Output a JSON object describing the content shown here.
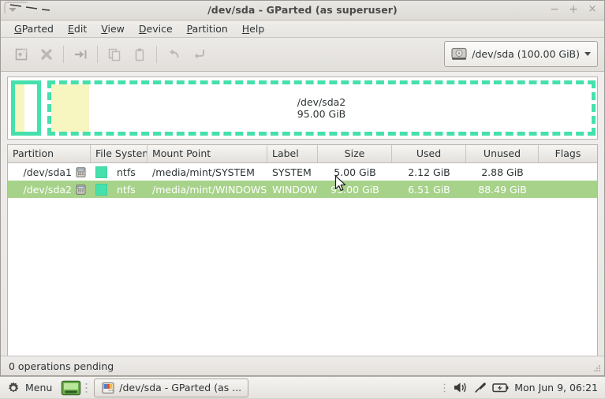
{
  "window": {
    "title": "/dev/sda - GParted (as superuser)",
    "controls": {
      "minimize": "−",
      "maximize": "+",
      "close": "×"
    }
  },
  "menubar": {
    "items": [
      {
        "label": "GParted",
        "mnemonic": "G"
      },
      {
        "label": "Edit",
        "mnemonic": "E"
      },
      {
        "label": "View",
        "mnemonic": "V"
      },
      {
        "label": "Device",
        "mnemonic": "D"
      },
      {
        "label": "Partition",
        "mnemonic": "P"
      },
      {
        "label": "Help",
        "mnemonic": "H"
      }
    ]
  },
  "toolbar": {
    "buttons": [
      {
        "name": "new-partition-icon",
        "enabled": false
      },
      {
        "name": "delete-partition-icon",
        "enabled": false
      },
      {
        "name": "resize-move-icon",
        "enabled": false
      },
      {
        "name": "copy-icon",
        "enabled": false
      },
      {
        "name": "paste-icon",
        "enabled": false
      },
      {
        "name": "undo-icon",
        "enabled": false
      },
      {
        "name": "apply-icon",
        "enabled": false
      }
    ],
    "device_selector": {
      "label": "/dev/sda  (100.00 GiB)",
      "icon": "harddisk-icon",
      "caret": "▼"
    }
  },
  "disk_graphic": {
    "blocks": [
      {
        "name": "/dev/sda1",
        "size_label": "5.00 GiB",
        "used_percent": 42,
        "selected": false,
        "show_caption": false,
        "border_color": "#45e0ab",
        "used_color": "#f7f5c0"
      },
      {
        "name": "/dev/sda2",
        "size_label": "95.00 GiB",
        "used_percent": 7,
        "selected": true,
        "show_caption": true,
        "border_color": "#45e0ab",
        "used_color": "#f7f5c0"
      }
    ]
  },
  "table": {
    "headers": [
      "Partition",
      "File System",
      "Mount Point",
      "Label",
      "Size",
      "Used",
      "Unused",
      "Flags"
    ],
    "rows": [
      {
        "partition": "/dev/sda1",
        "filesystem": "ntfs",
        "mount_point": "/media/mint/SYSTEM",
        "label": "SYSTEM",
        "size": "5.00 GiB",
        "used": "2.12 GiB",
        "unused": "2.88 GiB",
        "flags": "",
        "selected": false,
        "fs_color": "#45e0ab"
      },
      {
        "partition": "/dev/sda2",
        "filesystem": "ntfs",
        "mount_point": "/media/mint/WINDOWS",
        "label": "WINDOWS",
        "size": "95.00 GiB",
        "used": "6.51 GiB",
        "unused": "88.49 GiB",
        "flags": "",
        "selected": true,
        "fs_color": "#45e0ab"
      }
    ],
    "selection_color": "#a7d28a"
  },
  "statusbar": {
    "text": "0 operations pending"
  },
  "taskbar": {
    "menu_label": "Menu",
    "window_button": {
      "label": "/dev/sda - GParted (as ..."
    },
    "clock": "Mon Jun  9, 06:21"
  }
}
